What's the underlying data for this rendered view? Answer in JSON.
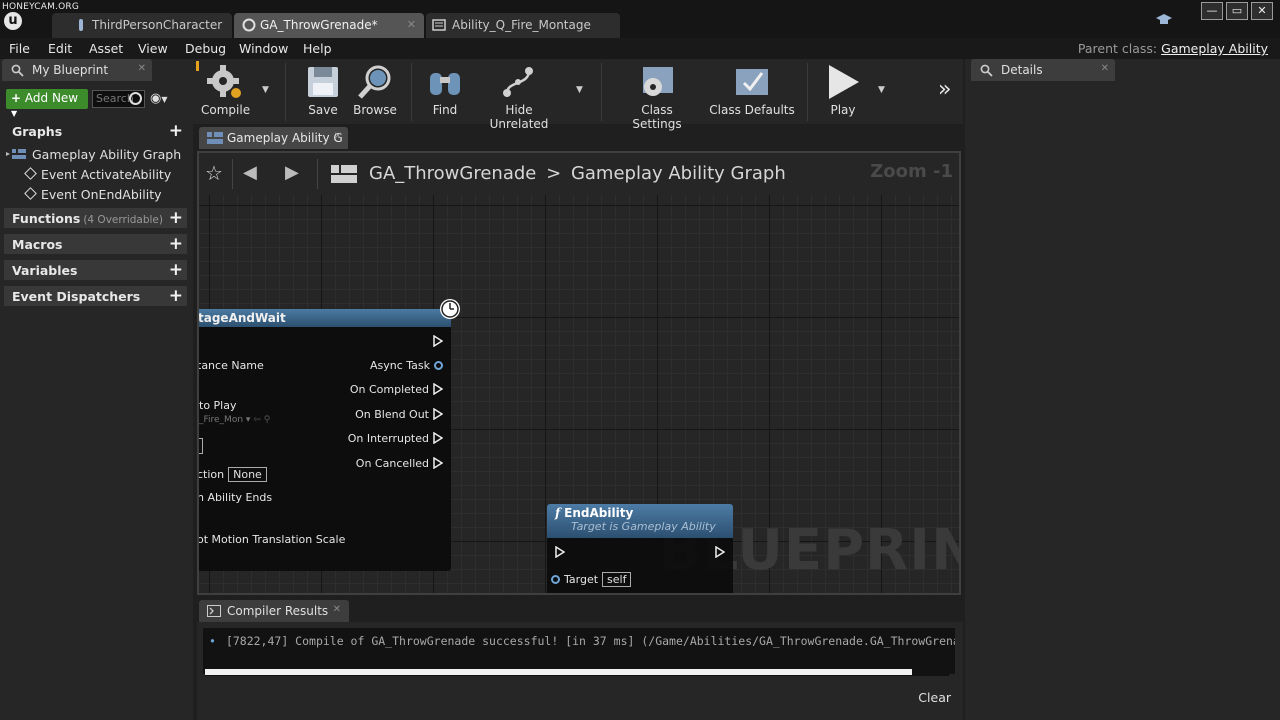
{
  "watermark": "HONEYCAM.ORG",
  "tabs": [
    {
      "label": "ThirdPersonCharacter",
      "active": false,
      "icon": "blueprint-character-icon"
    },
    {
      "label": "GA_ThrowGrenade*",
      "active": true,
      "icon": "blueprint-class-icon"
    },
    {
      "label": "Ability_Q_Fire_Montage",
      "active": false,
      "icon": "montage-icon"
    }
  ],
  "menu": [
    "File",
    "Edit",
    "Asset",
    "View",
    "Debug",
    "Window",
    "Help"
  ],
  "parent_class": {
    "label": "Parent class:",
    "value": "Gameplay Ability"
  },
  "my_blueprint": {
    "tab_label": "My Blueprint",
    "add_new_label": "Add New",
    "search_placeholder": "Search",
    "sections": {
      "graphs": "Graphs",
      "functions": "Functions",
      "functions_count": "(4 Overridable)",
      "macros": "Macros",
      "variables": "Variables",
      "dispatchers": "Event Dispatchers"
    },
    "graph_items": [
      "Gameplay Ability Graph",
      "Event ActivateAbility",
      "Event OnEndAbility"
    ]
  },
  "toolbar": {
    "compile": "Compile",
    "save": "Save",
    "browse": "Browse",
    "find": "Find",
    "hide_unrelated": "Hide Unrelated",
    "class_settings": "Class Settings",
    "class_defaults": "Class Defaults",
    "play": "Play"
  },
  "graph_tab": "Gameplay Ability G",
  "breadcrumb": {
    "asset": "GA_ThrowGrenade",
    "separator": ">",
    "graph": "Gameplay Ability Graph"
  },
  "zoom": "Zoom -1",
  "graph_watermark": "BLUEPRINT",
  "montage_node": {
    "title": "tageAndWait",
    "inputs": [
      "tance Name",
      "to Play",
      "_Fire_Mon",
      "ction",
      "n Ability Ends",
      "ot Motion Translation Scale"
    ],
    "section_value": "None",
    "outputs": [
      "Async Task",
      "On Completed",
      "On Blend Out",
      "On Interrupted",
      "On Cancelled"
    ]
  },
  "end_ability_node": {
    "title": "EndAbility",
    "subtitle": "Target is Gameplay Ability",
    "target_label": "Target",
    "target_value": "self"
  },
  "compiler_results": {
    "tab_label": "Compiler Results",
    "message": "[7822,47] Compile of GA_ThrowGrenade successful! [in 37 ms] (/Game/Abilities/GA_ThrowGrenade.GA_ThrowGrenade)",
    "progress": 0.95,
    "clear_label": "Clear"
  },
  "details": {
    "tab_label": "Details"
  }
}
